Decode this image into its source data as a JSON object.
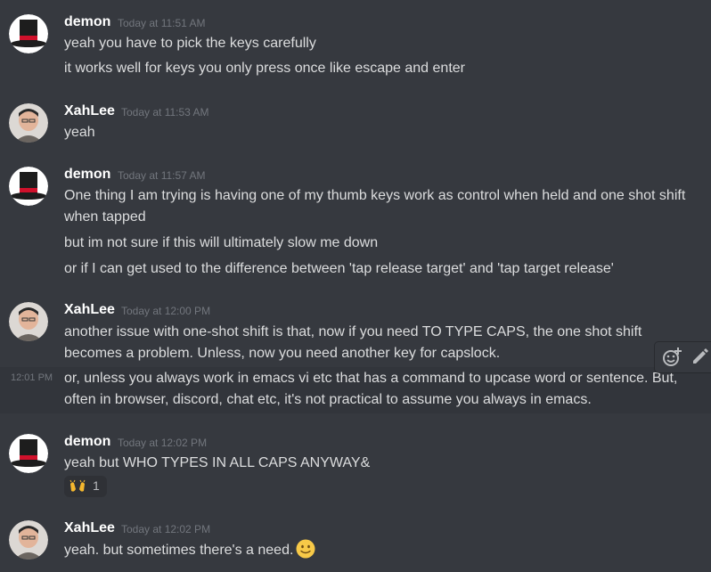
{
  "messages": [
    {
      "author": "demon",
      "timestamp": "Today at 11:51 AM",
      "avatar": "top-hat-avatar",
      "lines": [
        "yeah you have to pick the keys carefully",
        "it works well for keys you only press once like escape and enter"
      ]
    },
    {
      "author": "XahLee",
      "timestamp": "Today at 11:53 AM",
      "avatar": "user-photo-avatar",
      "lines": [
        "yeah"
      ]
    },
    {
      "author": "demon",
      "timestamp": "Today at 11:57 AM",
      "avatar": "top-hat-avatar",
      "lines": [
        "One thing I am trying is having one of my thumb keys work as control when held and one shot shift",
        "when tapped",
        "but im not sure if this will ultimately slow me down",
        "or if I can get used to the difference between 'tap release target' and 'tap target release'"
      ]
    },
    {
      "author": "XahLee",
      "timestamp": "Today at 12:00 PM",
      "avatar": "user-photo-avatar",
      "lines": [
        "another issue with one-shot shift is that, now if you need TO TYPE CAPS, the one shot shift",
        "becomes a problem. Unless, now you need another key for capslock.",
        "or, unless you always work in emacs vi etc that has a command to upcase word or sentence. But,",
        "often in browser, discord, chat etc, it's not practical to assume you always in emacs."
      ],
      "hover_time": "12:01 PM"
    },
    {
      "author": "demon",
      "timestamp": "Today at 12:02 PM",
      "avatar": "top-hat-avatar",
      "lines": [
        "yeah but WHO TYPES IN ALL CAPS ANYWAY&"
      ],
      "reaction": {
        "emoji": "raised-hands-emoji",
        "count": "1"
      }
    },
    {
      "author": "XahLee",
      "timestamp": "Today at 12:02 PM",
      "avatar": "user-photo-avatar",
      "lines": [
        "yeah. but sometimes there's a need."
      ],
      "inline_emoji": "slightly-smiling-face-emoji"
    }
  ],
  "message_actions": [
    "add-reaction-icon",
    "edit-pencil-icon"
  ],
  "colors": {
    "background": "#36393f",
    "hover_background": "#32353b",
    "text": "#dcddde",
    "author": "#ffffff",
    "timestamp": "#72767d"
  }
}
